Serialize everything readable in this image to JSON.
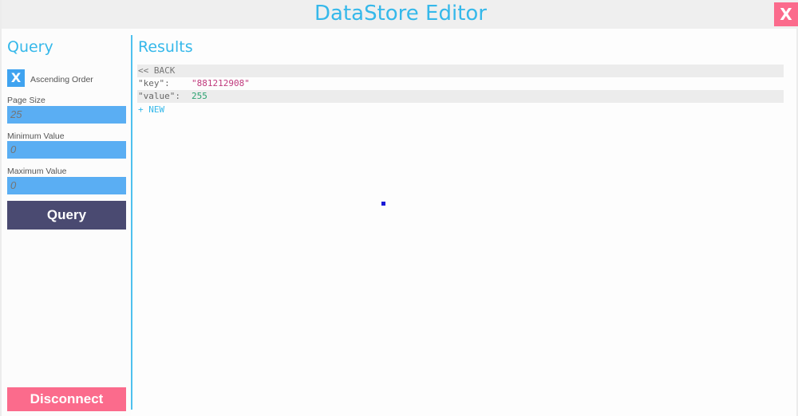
{
  "window": {
    "title": "DataStore Editor",
    "close_label": "X"
  },
  "query_panel": {
    "title": "Query",
    "ascending": {
      "checkbox_label": "X",
      "label": "Ascending Order",
      "checked": true
    },
    "page_size": {
      "label": "Page Size",
      "placeholder": "25"
    },
    "minimum_value": {
      "label": "Minimum Value",
      "placeholder": "0"
    },
    "maximum_value": {
      "label": "Maximum Value",
      "placeholder": "0"
    },
    "query_button": "Query",
    "disconnect_button": "Disconnect"
  },
  "results_panel": {
    "title": "Results",
    "back_label": "<< BACK",
    "entries": [
      {
        "key": "\"key\":",
        "value": "\"881212908\""
      },
      {
        "key": "\"value\":",
        "value": "255"
      }
    ],
    "new_label": "+ NEW"
  },
  "colors": {
    "accent": "#35b8ea",
    "field": "#5aaef3",
    "query_button": "#4a4a71",
    "danger": "#fb6b8c",
    "string_value": "#c03a7d",
    "number_value": "#2aa170"
  }
}
